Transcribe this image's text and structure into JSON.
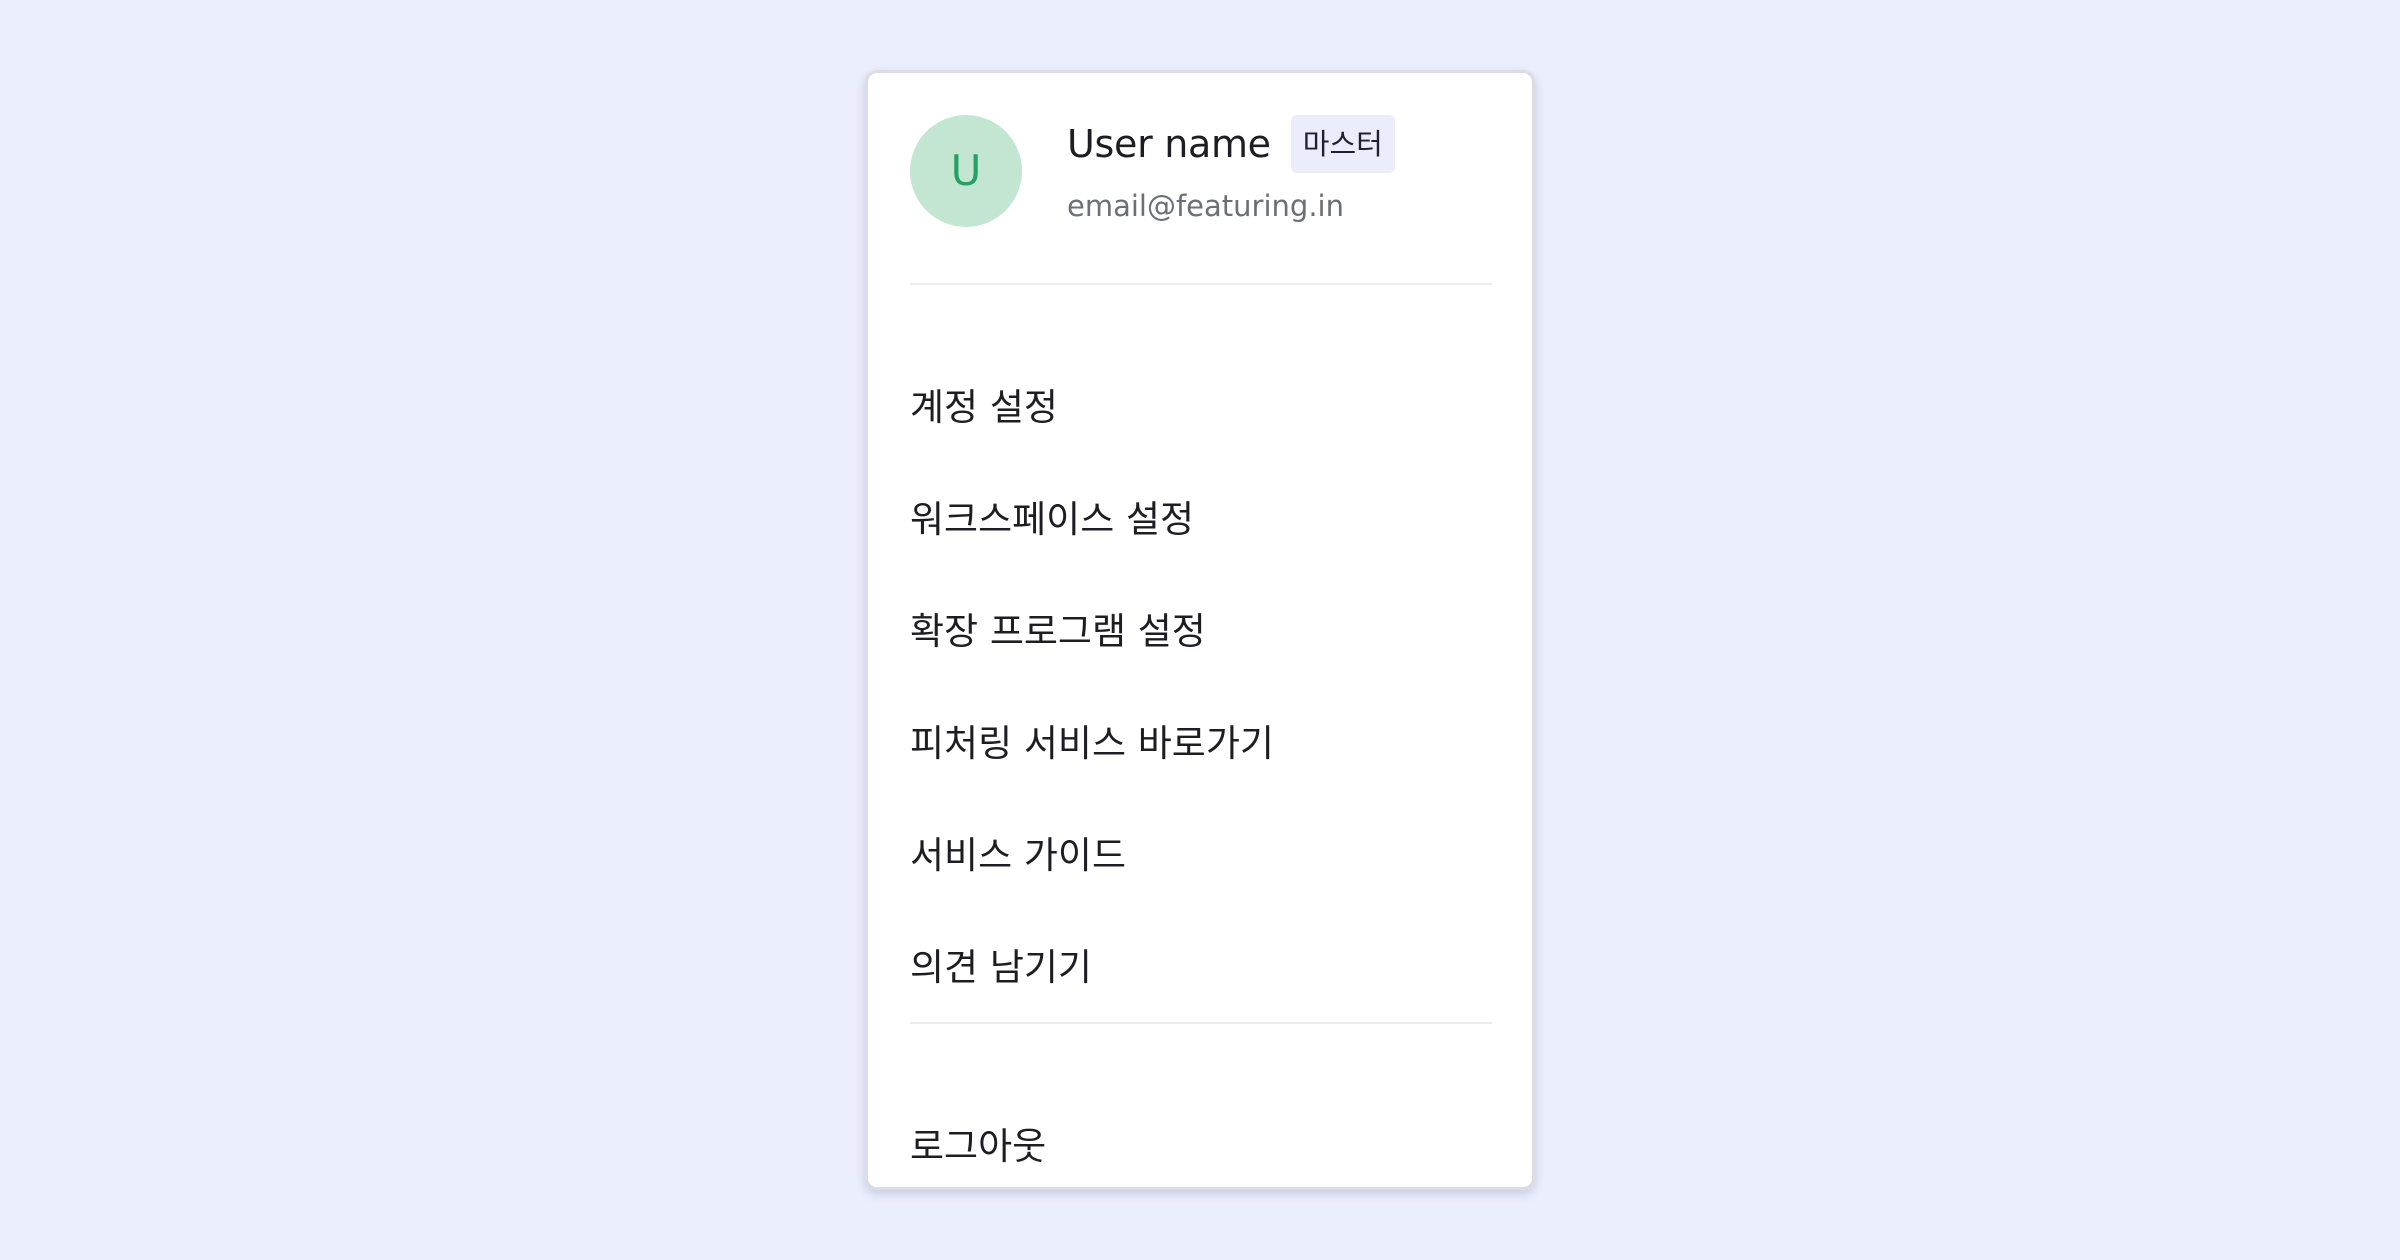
{
  "profile": {
    "avatar_initial": "U",
    "name": "User name",
    "role_badge": "마스터",
    "email": "email@featuring.in"
  },
  "menu": {
    "items": [
      {
        "label": "계정 설정"
      },
      {
        "label": "워크스페이스 설정"
      },
      {
        "label": "확장 프로그램 설정"
      },
      {
        "label": "피처링 서비스 바로가기"
      },
      {
        "label": "서비스 가이드"
      },
      {
        "label": "의견 남기기"
      }
    ],
    "logout_label": "로그아웃"
  },
  "colors": {
    "background": "#ebeefd",
    "avatar_bg": "#c3e6d3",
    "avatar_text": "#27a064",
    "badge_bg": "#ebedfc"
  }
}
